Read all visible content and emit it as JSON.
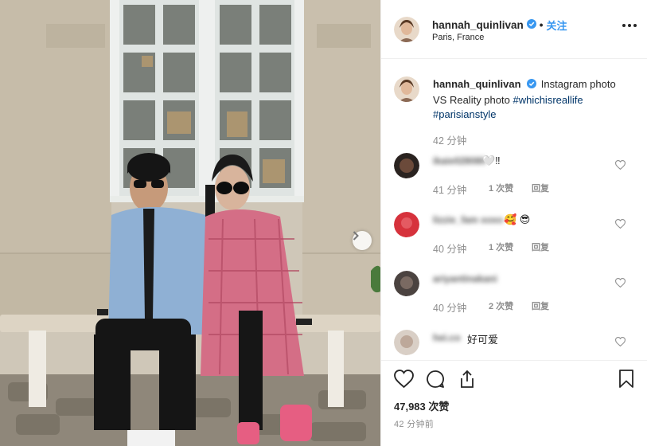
{
  "post": {
    "username": "hannah_quinlivan",
    "follow_label": "关注",
    "location": "Paris, France",
    "caption": {
      "text": "Instagram photo VS Reality photo",
      "hashtags": [
        "#whichisreallife",
        "#parisianstyle"
      ],
      "time": "42 分钟"
    },
    "comments": [
      {
        "user": "ikaie028080",
        "text": "🤍‼",
        "time": "41 分钟",
        "likes": "1 次赞",
        "reply": "回复"
      },
      {
        "user": "lizzie_fam xoxo",
        "text": "🥰 😎",
        "time": "40 分钟",
        "likes": "1 次赞",
        "reply": "回复"
      },
      {
        "user": "ariyantinakani",
        "text": "🤍",
        "time": "40 分钟",
        "likes": "2 次赞",
        "reply": "回复"
      },
      {
        "user": "hei.co",
        "text": "好可爱",
        "time": "",
        "likes": "",
        "reply": ""
      }
    ],
    "likes_count": "47,983 次赞",
    "posted_time": "42 分钟前"
  },
  "colors": {
    "link": "#3897f0",
    "hashtag": "#003569",
    "verified": "#3897f0",
    "muted": "#8e8e8e"
  },
  "icons": {
    "verified": "verified-badge-icon",
    "more": "more-options-icon",
    "like": "heart-icon",
    "comment": "comment-icon",
    "share": "share-icon",
    "save": "bookmark-icon",
    "next": "chevron-right-icon"
  }
}
